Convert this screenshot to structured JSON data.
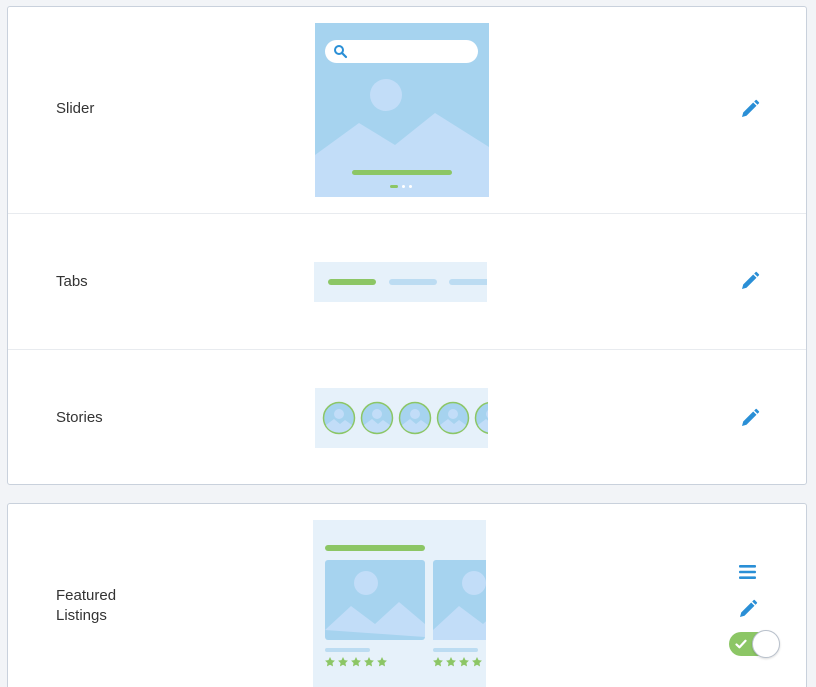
{
  "sections": [
    {
      "rows": [
        {
          "label": "Slider"
        },
        {
          "label": "Tabs"
        },
        {
          "label": "Stories"
        }
      ]
    },
    {
      "rows": [
        {
          "label_line1": "Featured",
          "label_line2": "Listings",
          "toggle_on": true
        }
      ]
    }
  ],
  "icons": {
    "edit": "pencil-icon",
    "reorder": "menu-icon",
    "search": "search-icon",
    "check": "check-icon",
    "star": "star-icon"
  },
  "colors": {
    "accent": "#2a8fd6",
    "green": "#8cc665",
    "preview_bg": "#a6d3ef",
    "preview_light": "#e6f1fa",
    "mountain": "#c2ddf8"
  }
}
